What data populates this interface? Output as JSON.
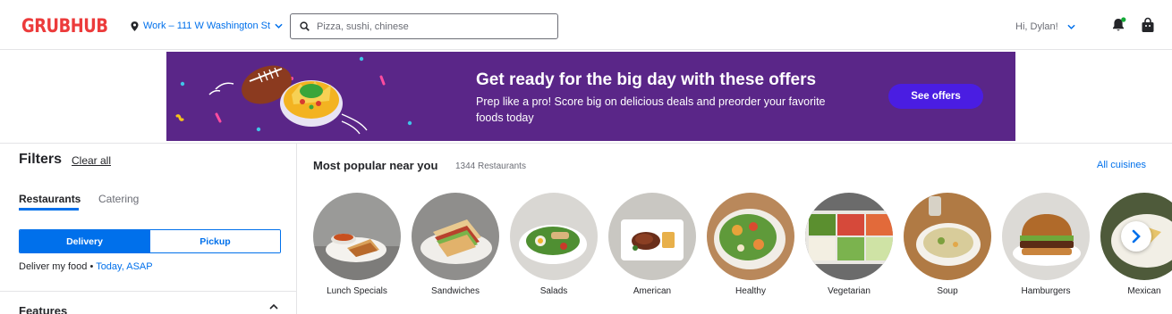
{
  "header": {
    "logo": "GRUBHUB",
    "location": "Work – 111 W Washington St",
    "search_placeholder": "Pizza, sushi, chinese",
    "greeting": "Hi, Dylan!"
  },
  "banner": {
    "title": "Get ready for the big day with these offers",
    "body": "Prep like a pro! Score big on delicious deals and preorder your favorite foods today",
    "button": "See offers"
  },
  "sidebar": {
    "title": "Filters",
    "clear_all": "Clear all",
    "tabs": [
      {
        "label": "Restaurants",
        "active": true
      },
      {
        "label": "Catering",
        "active": false
      }
    ],
    "mode": {
      "delivery": "Delivery",
      "pickup": "Pickup",
      "selected": "Delivery"
    },
    "deliver_prefix": "Deliver my food • ",
    "deliver_time": "Today, ASAP",
    "features": "Features"
  },
  "main": {
    "title": "Most popular near you",
    "count": "1344 Restaurants",
    "all_cuisines": "All cuisines",
    "cuisines": [
      {
        "label": "Lunch Specials"
      },
      {
        "label": "Sandwiches"
      },
      {
        "label": "Salads"
      },
      {
        "label": "American"
      },
      {
        "label": "Healthy"
      },
      {
        "label": "Vegetarian"
      },
      {
        "label": "Soup"
      },
      {
        "label": "Hamburgers"
      },
      {
        "label": "Mexican"
      }
    ]
  },
  "colors": {
    "brand": "#ec3b3b",
    "link": "#0070eb",
    "banner_bg": "#5a2688",
    "banner_button": "#4a1de2"
  }
}
